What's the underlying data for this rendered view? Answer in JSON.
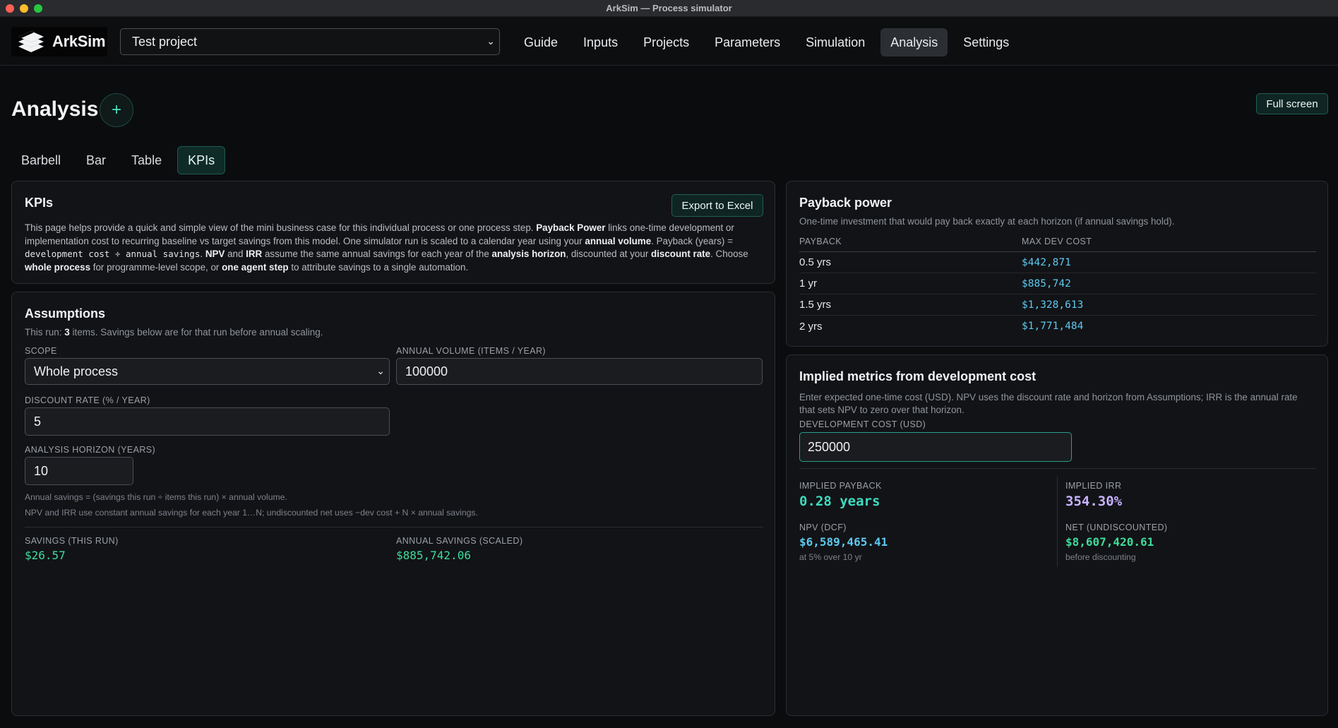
{
  "window": {
    "title": "ArkSim — Process simulator"
  },
  "app": {
    "name": "ArkSim",
    "logo_icon": "arksim-logo-icon"
  },
  "project_selector": {
    "value": "Test project"
  },
  "nav": {
    "items": [
      {
        "label": "Guide"
      },
      {
        "label": "Inputs"
      },
      {
        "label": "Projects"
      },
      {
        "label": "Parameters"
      },
      {
        "label": "Simulation"
      },
      {
        "label": "Analysis",
        "active": true
      },
      {
        "label": "Settings"
      }
    ]
  },
  "page": {
    "title": "Analysis",
    "add_label": "+",
    "fullscreen_label": "Full screen"
  },
  "tabs": [
    {
      "label": "Barbell"
    },
    {
      "label": "Bar"
    },
    {
      "label": "Table"
    },
    {
      "label": "KPIs",
      "active": true
    }
  ],
  "kpi_card": {
    "title": "KPIs",
    "export_label": "Export to Excel",
    "desc": {
      "p1": "This page helps provide a quick and simple view of the mini business case for this individual process or one process step. ",
      "b1": "Payback Power",
      "p2": " links one-time development or implementation cost to recurring baseline vs target savings from this model. One simulator run is scaled to a calendar year using your ",
      "b2": "annual volume",
      "p3": ". Payback (years) = ",
      "code": "development cost ÷ annual savings",
      "p4": ". ",
      "b3": "NPV",
      "p5": " and ",
      "b4": "IRR",
      "p6": " assume the same annual savings for each year of the ",
      "b5": "analysis horizon",
      "p7": ", discounted at your ",
      "b6": "discount rate",
      "p8": ". Choose ",
      "b7": "whole process",
      "p9": " for programme-level scope, or ",
      "b8": "one agent step",
      "p10": " to attribute savings to a single automation."
    }
  },
  "assumptions": {
    "title": "Assumptions",
    "sub_prefix": "This run: ",
    "sub_count": "3",
    "sub_suffix": " items. Savings below are for that run before annual scaling.",
    "scope_label": "SCOPE",
    "scope_value": "Whole process",
    "volume_label": "ANNUAL VOLUME (ITEMS / YEAR)",
    "volume_value": "100000",
    "discount_label": "DISCOUNT RATE (% / YEAR)",
    "discount_value": "5",
    "horizon_label": "ANALYSIS HORIZON (YEARS)",
    "horizon_value": "10",
    "note1": "Annual savings = (savings this run ÷ items this run) × annual volume.",
    "note2": "NPV and IRR use constant annual savings for each year 1…N; undiscounted net uses −dev cost + N × annual savings.",
    "savings_run_label": "SAVINGS (THIS RUN)",
    "savings_run_value": "$26.57",
    "annual_savings_label": "ANNUAL SAVINGS (SCALED)",
    "annual_savings_value": "$885,742.06"
  },
  "payback": {
    "title": "Payback power",
    "subtitle": "One-time investment that would pay back exactly at each horizon (if annual savings hold).",
    "col1": "PAYBACK",
    "col2": "MAX DEV COST",
    "rows": [
      {
        "period": "0.5 yrs",
        "cost": "$442,871"
      },
      {
        "period": "1 yr",
        "cost": "$885,742"
      },
      {
        "period": "1.5 yrs",
        "cost": "$1,328,613"
      },
      {
        "period": "2 yrs",
        "cost": "$1,771,484"
      }
    ]
  },
  "implied": {
    "title": "Implied metrics from development cost",
    "desc": "Enter expected one-time cost (USD). NPV uses the discount rate and horizon from Assumptions; IRR is the annual rate that sets NPV to zero over that horizon.",
    "dev_label": "DEVELOPMENT COST (USD)",
    "dev_value": "250000",
    "payback_label": "IMPLIED PAYBACK",
    "payback_value": "0.28 years",
    "irr_label": "IMPLIED IRR",
    "irr_value": "354.30%",
    "npv_label": "NPV (DCF)",
    "npv_value": "$6,589,465.41",
    "npv_sub": "at 5% over 10 yr",
    "net_label": "NET (UNDISCOUNTED)",
    "net_value": "$8,607,420.61",
    "net_sub": "before discounting"
  },
  "colors": {
    "accent_teal": "#2a9d8c",
    "green_value": "#3ddc9c",
    "blue_value": "#5ec8ef",
    "purple_value": "#c7b3ff"
  }
}
